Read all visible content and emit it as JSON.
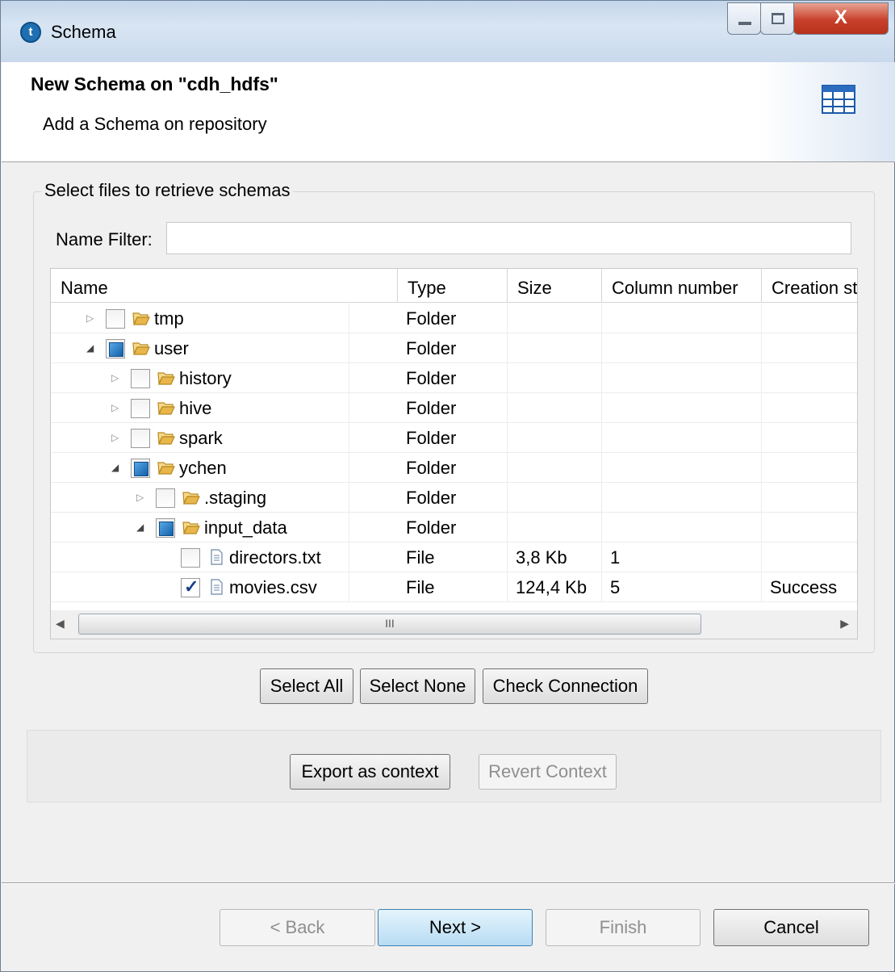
{
  "window": {
    "title": "Schema",
    "close_glyph": "X"
  },
  "header": {
    "title": "New Schema on \"cdh_hdfs\"",
    "subtitle": "Add a Schema on repository"
  },
  "group": {
    "legend": "Select files to retrieve schemas",
    "filter_label": "Name Filter:",
    "filter_value": ""
  },
  "table": {
    "columns": [
      "Name",
      "Type",
      "Size",
      "Column number",
      "Creation status"
    ],
    "rows": [
      {
        "name": "tmp",
        "depth": 0,
        "expand": "collapsed",
        "check": "unchecked",
        "kind": "folder",
        "type": "Folder",
        "size": "",
        "colnum": "",
        "status": ""
      },
      {
        "name": "user",
        "depth": 0,
        "expand": "expanded",
        "check": "partial",
        "kind": "folder",
        "type": "Folder",
        "size": "",
        "colnum": "",
        "status": ""
      },
      {
        "name": "history",
        "depth": 1,
        "expand": "collapsed",
        "check": "unchecked",
        "kind": "folder",
        "type": "Folder",
        "size": "",
        "colnum": "",
        "status": ""
      },
      {
        "name": "hive",
        "depth": 1,
        "expand": "collapsed",
        "check": "unchecked",
        "kind": "folder",
        "type": "Folder",
        "size": "",
        "colnum": "",
        "status": ""
      },
      {
        "name": "spark",
        "depth": 1,
        "expand": "collapsed",
        "check": "unchecked",
        "kind": "folder",
        "type": "Folder",
        "size": "",
        "colnum": "",
        "status": ""
      },
      {
        "name": "ychen",
        "depth": 1,
        "expand": "expanded",
        "check": "partial",
        "kind": "folder",
        "type": "Folder",
        "size": "",
        "colnum": "",
        "status": ""
      },
      {
        "name": ".staging",
        "depth": 2,
        "expand": "collapsed",
        "check": "unchecked",
        "kind": "folder",
        "type": "Folder",
        "size": "",
        "colnum": "",
        "status": ""
      },
      {
        "name": "input_data",
        "depth": 2,
        "expand": "expanded",
        "check": "partial",
        "kind": "folder",
        "type": "Folder",
        "size": "",
        "colnum": "",
        "status": ""
      },
      {
        "name": "directors.txt",
        "depth": 3,
        "expand": "none",
        "check": "unchecked",
        "kind": "file",
        "type": "File",
        "size": "3,8 Kb",
        "colnum": "1",
        "status": ""
      },
      {
        "name": "movies.csv",
        "depth": 3,
        "expand": "none",
        "check": "checked",
        "kind": "file",
        "type": "File",
        "size": "124,4 Kb",
        "colnum": "5",
        "status": "Success"
      }
    ]
  },
  "scrollbar": {
    "thumb_grip": "III"
  },
  "buttons": {
    "select_all": "Select All",
    "select_none": "Select None",
    "check_connection": "Check Connection",
    "export_context": "Export as context",
    "revert_context": "Revert Context",
    "back": "< Back",
    "next": "Next >",
    "finish": "Finish",
    "cancel": "Cancel"
  },
  "colors": {
    "accent": "#1f6fb2",
    "folder": "#e8b64a",
    "close": "#c8402b"
  }
}
